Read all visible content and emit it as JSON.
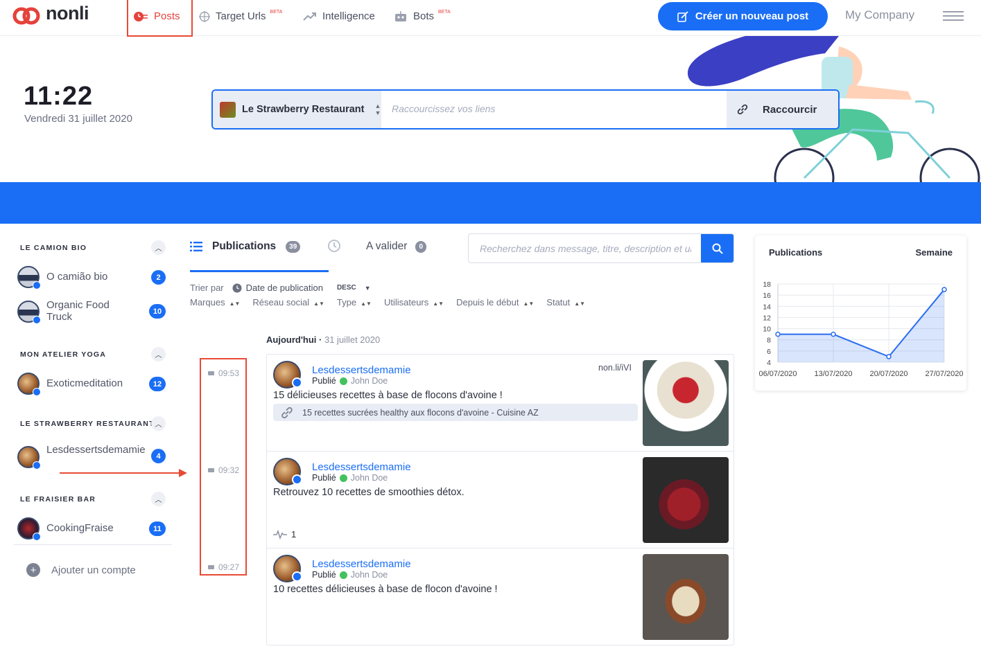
{
  "nav": {
    "logo": "nonli",
    "items": [
      {
        "label": "Posts",
        "beta": ""
      },
      {
        "label": "Target Urls",
        "beta": "BETA"
      },
      {
        "label": "Intelligence",
        "beta": ""
      },
      {
        "label": "Bots",
        "beta": "BETA"
      }
    ],
    "create_label": "Créer un nouveau post",
    "company": "My Company"
  },
  "hero": {
    "time": "11:22",
    "date": "Vendredi 31 juillet 2020",
    "brand": "Le Strawberry Restaurant",
    "shorten_placeholder": "Raccourcissez vos liens",
    "shorten_button": "Raccourcir"
  },
  "sidebar": {
    "groups": [
      {
        "title": "LE CAMION BIO",
        "accounts": [
          {
            "name": "O camião bio",
            "count": "2"
          },
          {
            "name": "Organic Food Truck",
            "count": "10"
          }
        ]
      },
      {
        "title": "MON ATELIER YOGA",
        "accounts": [
          {
            "name": "Exoticmeditation",
            "count": "12"
          }
        ]
      },
      {
        "title": "LE STRAWBERRY RESTAURANT",
        "accounts": [
          {
            "name": "Lesdessertsdemamie",
            "count": "4"
          }
        ]
      },
      {
        "title": "LE FRAISIER BAR",
        "accounts": [
          {
            "name": "CookingFraise",
            "count": "11"
          }
        ]
      }
    ],
    "add_account": "Ajouter un compte"
  },
  "main": {
    "tab_publications": "Publications",
    "tab_publications_count": "39",
    "tab_validate": "A valider",
    "tab_validate_count": "0",
    "search_placeholder": "Recherchez dans message, titre, description et url",
    "sort_label": "Trier par",
    "sort_field": "Date de publication",
    "sort_order": "DESC",
    "filters": [
      "Marques",
      "Réseau social",
      "Type",
      "Utilisateurs",
      "Depuis le début",
      "Statut"
    ],
    "day_label": "Aujourd'hui",
    "day_date": "31 juillet 2020",
    "times": [
      "09:53",
      "09:32",
      "09:27"
    ],
    "posts": [
      {
        "account": "Lesdessertsdemamie",
        "status": "Publié",
        "user": "John Doe",
        "message": "15 délicieuses recettes à base de flocons d'avoine !",
        "link": "non.li/iVI",
        "preview": "15 recettes sucrées healthy aux flocons d'avoine - Cuisine AZ",
        "stat": ""
      },
      {
        "account": "Lesdessertsdemamie",
        "status": "Publié",
        "user": "John Doe",
        "message": "Retrouvez 10 recettes de smoothies détox.",
        "link": "",
        "preview": "",
        "stat": "1"
      },
      {
        "account": "Lesdessertsdemamie",
        "status": "Publié",
        "user": "John Doe",
        "message": "10 recettes délicieuses à base de flocon d'avoine !",
        "link": "",
        "preview": "",
        "stat": ""
      }
    ]
  },
  "chart_data": {
    "type": "area",
    "title": "Publications",
    "period": "Semaine",
    "categories": [
      "06/07/2020",
      "13/07/2020",
      "20/07/2020",
      "27/07/2020"
    ],
    "values": [
      9,
      9,
      5,
      17
    ],
    "ylim": [
      4,
      18
    ],
    "yticks": [
      4,
      6,
      8,
      10,
      12,
      14,
      16,
      18
    ],
    "color": "#2a6df0"
  }
}
